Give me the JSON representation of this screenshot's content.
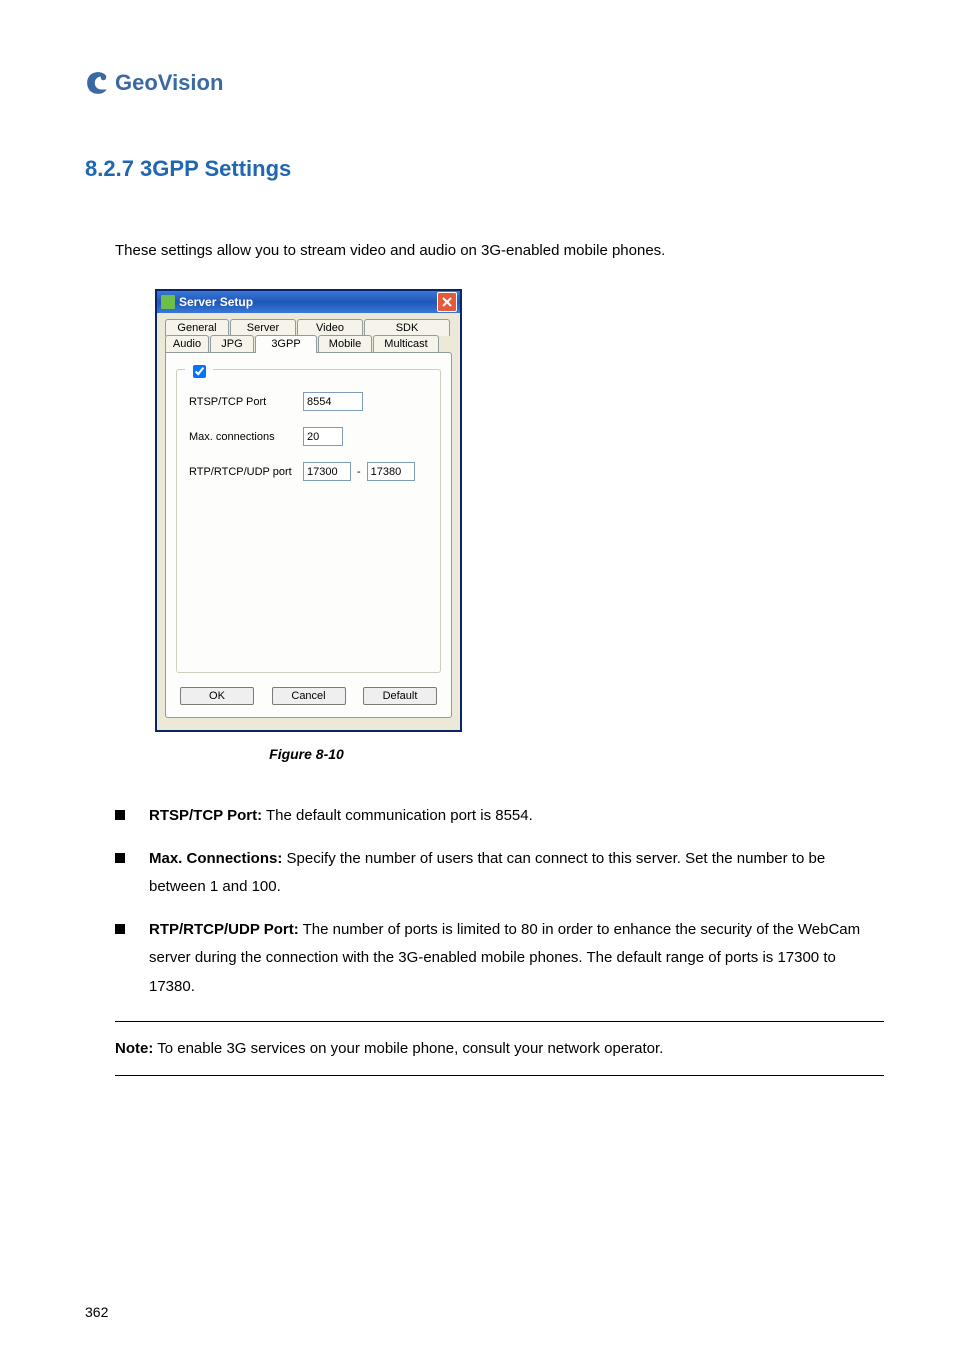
{
  "brand": {
    "name": "GeoVision"
  },
  "heading": "8.2.7   3GPP Settings",
  "intro": "These settings allow you to stream video and audio on 3G-enabled mobile phones.",
  "dialog": {
    "title": "Server Setup",
    "tabs_row1": [
      "General",
      "Server",
      "Video",
      "SDK"
    ],
    "tabs_row2": [
      "Audio",
      "JPG",
      "3GPP",
      "Mobile",
      "Multicast"
    ],
    "checkbox_checked": true,
    "fields": {
      "rtsp_label": "RTSP/TCP Port",
      "rtsp_value": "8554",
      "maxconn_label": "Max. connections",
      "maxconn_value": "20",
      "rtp_label": "RTP/RTCP/UDP port",
      "rtp_from": "17300",
      "rtp_to": "17380",
      "dash": "-"
    },
    "buttons": {
      "ok": "OK",
      "cancel": "Cancel",
      "default": "Default"
    }
  },
  "figure_caption": "Figure 8-10",
  "bullets": [
    {
      "term": "RTSP/TCP Port:",
      "desc": " The default communication port is 8554."
    },
    {
      "term": "Max. Connections:",
      "desc": " Specify the number of users that can connect to this server. Set the number to be between 1 and 100."
    },
    {
      "term": "RTP/RTCP/UDP Port:",
      "desc": " The number of ports is limited to 80 in order to enhance the security of the WebCam server during the connection with the 3G-enabled mobile phones. The default range of ports is 17300 to 17380."
    }
  ],
  "note": {
    "term": "Note:",
    "desc": " To enable 3G services on your mobile phone, consult your network operator."
  },
  "page_number": "362"
}
